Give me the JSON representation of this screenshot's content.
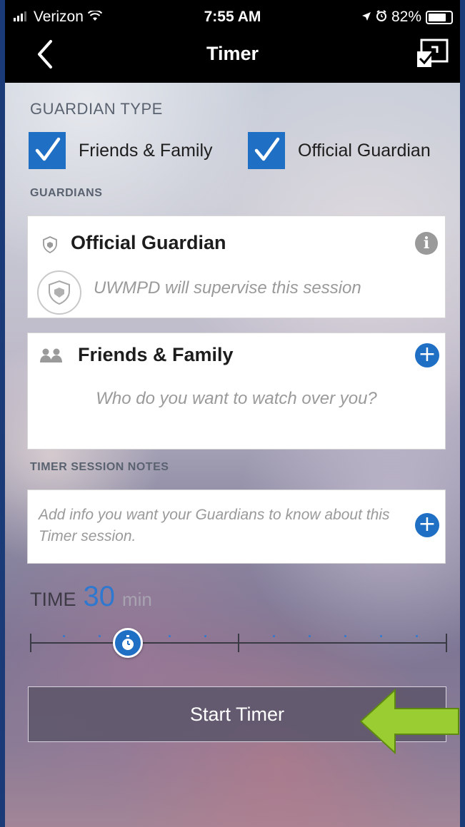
{
  "status_bar": {
    "carrier": "Verizon",
    "time": "7:55 AM",
    "battery": "82%"
  },
  "nav": {
    "title": "Timer"
  },
  "guardian_type": {
    "label": "GUARDIAN TYPE",
    "options": [
      {
        "label": "Friends & Family",
        "checked": true
      },
      {
        "label": "Official Guardian",
        "checked": true
      }
    ]
  },
  "guardians": {
    "label": "GUARDIANS",
    "official": {
      "title": "Official Guardian",
      "subtitle": "UWMPD will supervise this session"
    },
    "friends": {
      "title": "Friends & Family",
      "placeholder": "Who do you want to watch over you?"
    }
  },
  "notes": {
    "label": "TIMER SESSION NOTES",
    "placeholder": "Add info you want your Guardians to know about this Timer session."
  },
  "time": {
    "label": "TIME",
    "value": "30",
    "unit": "min"
  },
  "start_button": {
    "label": "Start Timer"
  },
  "colors": {
    "accent": "#1f6fc4",
    "arrow": "#9acd32"
  }
}
